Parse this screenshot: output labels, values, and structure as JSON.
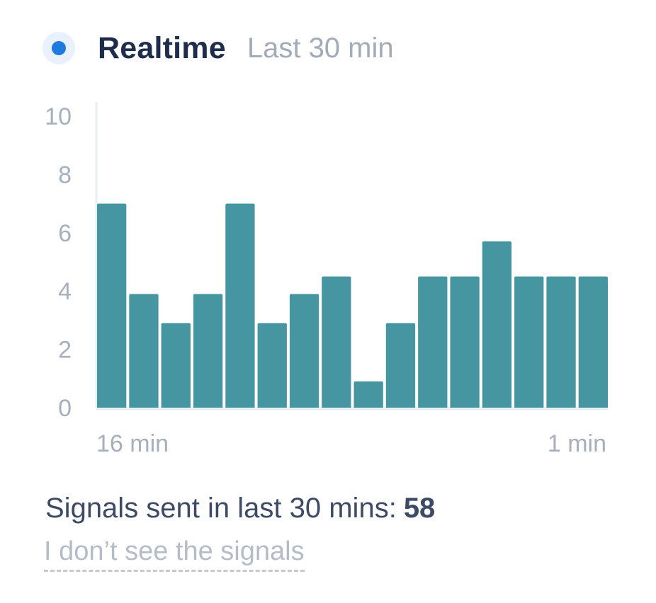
{
  "header": {
    "title": "Realtime",
    "subtitle": "Last 30 min"
  },
  "colors": {
    "live_dot": "#1f7ae0",
    "bar": "#4596a0",
    "axis": "#e4f0f6"
  },
  "chart_data": {
    "type": "bar",
    "title": "",
    "xlabel": "",
    "ylabel": "",
    "ylim": [
      0,
      10
    ],
    "y_ticks": [
      "0",
      "2",
      "4",
      "6",
      "8",
      "10"
    ],
    "x_tick_labels": [
      "16 min",
      "1 min"
    ],
    "grid": false,
    "values": [
      7,
      3.9,
      2.9,
      3.9,
      7,
      2.9,
      3.9,
      4.5,
      0.9,
      2.9,
      4.5,
      4.5,
      5.7,
      4.5,
      4.5,
      4.5
    ]
  },
  "summary": {
    "label": "Signals sent in last 30 mins:",
    "count": "58"
  },
  "help_link": {
    "label": "I don’t see the signals"
  }
}
